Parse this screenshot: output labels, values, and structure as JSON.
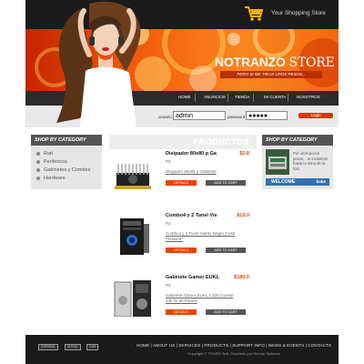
{
  "header": {
    "store_tagline": "Your Shopping Store"
  },
  "banner": {
    "brand_main": "NOTRANZO ",
    "brand_accent": "STORE",
    "slogan": "PERO SI ME TIRAS UNOS PESOS..."
  },
  "nav": {
    "items": [
      {
        "label": "Home"
      },
      {
        "label": "Anuncios"
      },
      {
        "label": "Tienda"
      },
      {
        "label": "Mi Cuenta"
      },
      {
        "label": "Nosotros"
      }
    ]
  },
  "login": {
    "user_label": "usuario",
    "user_value": "admin",
    "pass_label": "password",
    "pass_value": "●●●●●",
    "button": "Login"
  },
  "sidebar_left": {
    "heading": "SHOP BY CATEGORY",
    "categories": [
      "Ratt",
      "Perifericos",
      "Gabinetes y Combos",
      "Hardware"
    ]
  },
  "products": {
    "heading": "PRODUCTOS",
    "items": [
      {
        "name": "Disipador 80x80 p Ga",
        "price": "$2.8",
        "code": "P3",
        "desc": "Disipador 80x80 p Gabinete",
        "details": "DETAILS",
        "add": "ADD TO CART"
      },
      {
        "name": "Combo4 y 2 Tunel Vie",
        "price": "$15.0",
        "code": "P3",
        "desc": "Combo4 y 2 Tunel Viento Negro 2 usb FD3524P",
        "details": "DETAILS",
        "add": "ADD TO CART"
      },
      {
        "name": "Gabinete Gamer EUKL",
        "price": "$180.0",
        "code": "P3",
        "desc": "Gabinete Gamer EUKL 1-225 Fuente 430 W Sk-Panels",
        "details": "DETAILS",
        "add": "ADD TO CART"
      }
    ]
  },
  "sidebar_right": {
    "heading": "SHOP BY CATEGORY",
    "text": "Por unos pocos pesos... te incluimos hasta la mina de la foto",
    "welcome": "WELCOME",
    "babe": "babe"
  },
  "footer": {
    "badges": [
      "ESPAÑOL",
      "XHTML",
      "CSS"
    ],
    "links": "HOME | ABOUT US | SERVICES | PRODUCTS | SUPPORT INFO | NEWS & EVENTS | CONTACTS",
    "copyright": "Copyright © TPORG Soft. Diseñado por Hernan Sellanes"
  },
  "colors": {
    "accent": "#e94300",
    "dark": "#1b1b1b",
    "price": "#e04800"
  },
  "icons": [
    "cart-icon",
    "category-bullet-icon"
  ]
}
